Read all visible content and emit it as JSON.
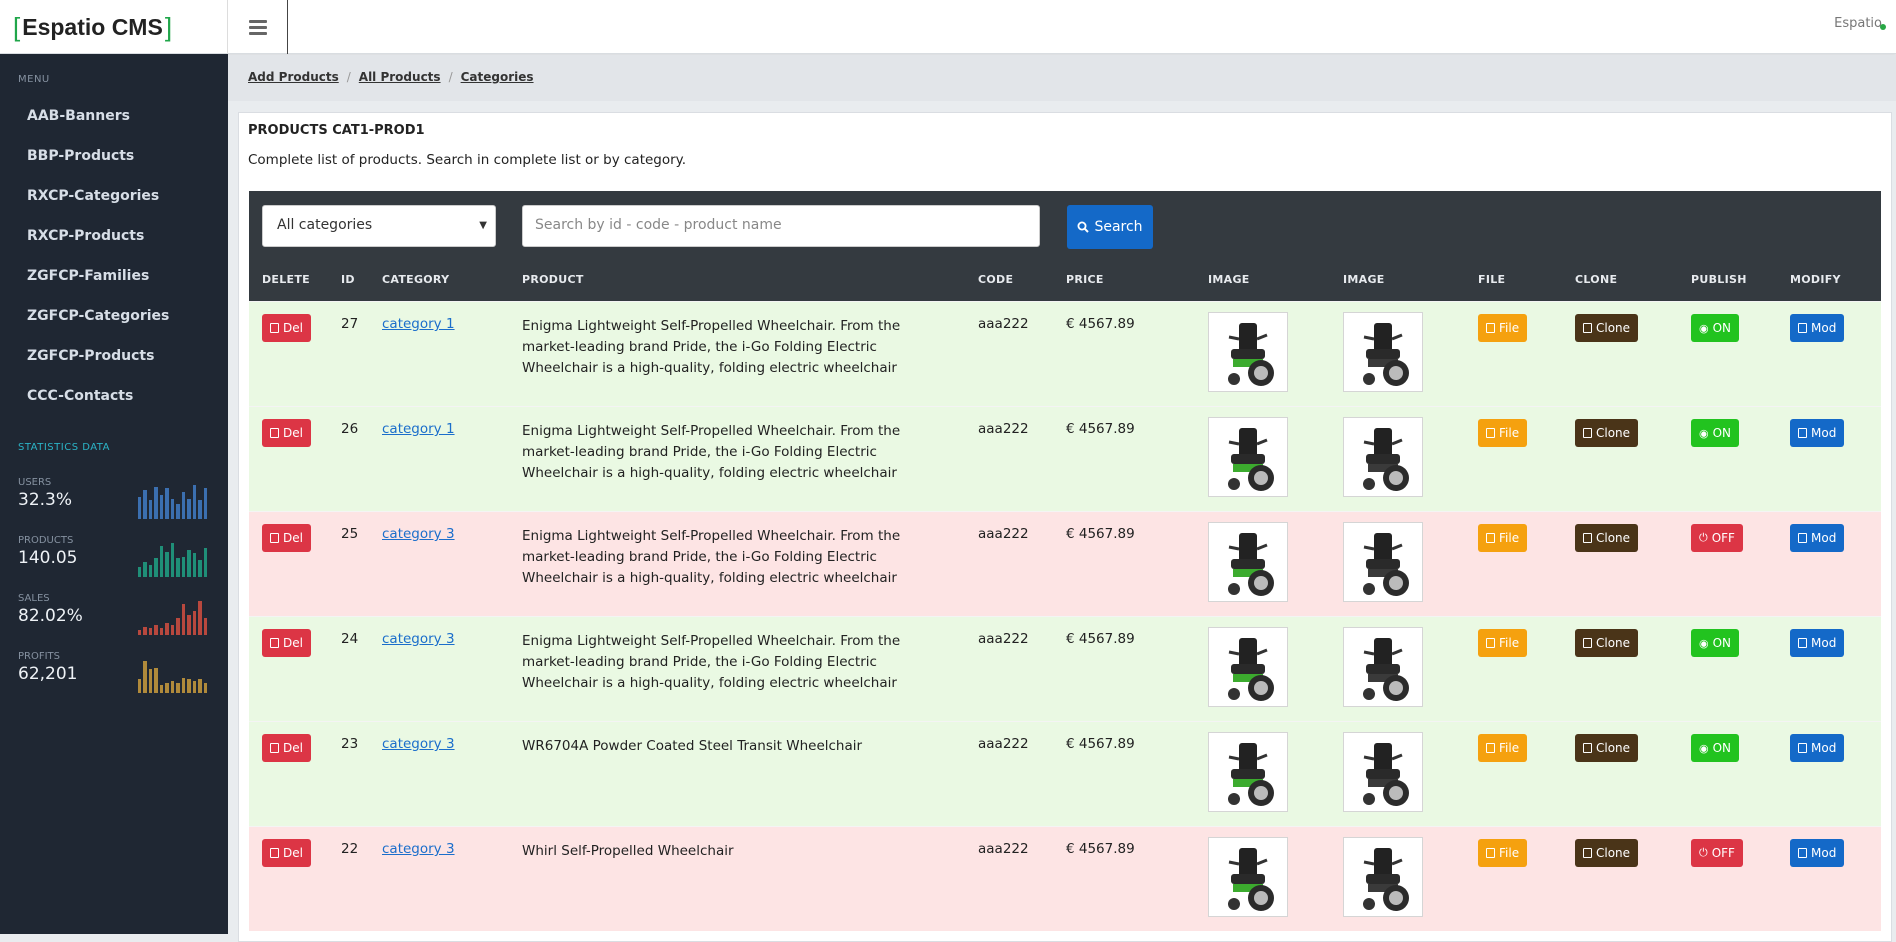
{
  "brand": {
    "name": "Espatio CMS",
    "bracket_left": "[",
    "bracket_right": "]"
  },
  "header": {
    "user_name": "Espatio"
  },
  "sidebar": {
    "menu_title": "MENU",
    "items": [
      {
        "label": "AAB-Banners"
      },
      {
        "label": "BBP-Products"
      },
      {
        "label": "RXCP-Categories"
      },
      {
        "label": "RXCP-Products"
      },
      {
        "label": "ZGFCP-Families"
      },
      {
        "label": "ZGFCP-Categories"
      },
      {
        "label": "ZGFCP-Products"
      },
      {
        "label": "CCC-Contacts"
      }
    ],
    "stats_title": "STATISTICS DATA",
    "stats": [
      {
        "label": "USERS",
        "value": "32.3%",
        "color": "#3b6fb0",
        "bars": [
          0.65,
          0.85,
          0.55,
          0.95,
          0.7,
          0.9,
          0.6,
          0.45,
          0.8,
          0.6,
          1.0,
          0.55,
          0.9
        ]
      },
      {
        "label": "PRODUCTS",
        "value": "140.05",
        "color": "#1f8f78",
        "bars": [
          0.3,
          0.45,
          0.35,
          0.55,
          0.9,
          0.75,
          1.0,
          0.55,
          0.6,
          0.8,
          0.7,
          0.5,
          0.85
        ]
      },
      {
        "label": "SALES",
        "value": "82.02%",
        "color": "#b8483e",
        "bars": [
          0.15,
          0.25,
          0.2,
          0.3,
          0.2,
          0.35,
          0.3,
          0.5,
          0.9,
          0.6,
          0.7,
          1.0,
          0.5
        ]
      },
      {
        "label": "PROFITS",
        "value": "62,201",
        "color": "#b08a3b",
        "bars": [
          0.4,
          0.95,
          0.7,
          0.75,
          0.25,
          0.3,
          0.35,
          0.3,
          0.45,
          0.4,
          0.35,
          0.4,
          0.3
        ]
      }
    ]
  },
  "breadcrumb": [
    "Add Products",
    "All Products",
    "Categories"
  ],
  "main": {
    "title": "PRODUCTS CAT1-PROD1",
    "description": "Complete list of products. Search in complete list or by category.",
    "filter_select": "All categories",
    "search_placeholder": "Search by id - code - product name",
    "search_button": "Search",
    "columns": [
      "DELETE",
      "ID",
      "CATEGORY",
      "PRODUCT",
      "CODE",
      "PRICE",
      "IMAGE",
      "IMAGE",
      "FILE",
      "CLONE",
      "PUBLISH",
      "MODIFY"
    ],
    "buttons": {
      "del": "Del",
      "file": "File",
      "clone": "Clone",
      "mod": "Mod"
    },
    "rows": [
      {
        "id": "27",
        "category": "category 1",
        "product": "Enigma Lightweight Self-Propelled Wheelchair. From the market-leading brand Pride, the i-Go Folding Electric Wheelchair is a high-quality, folding electric wheelchair",
        "code": "aaa222",
        "price": "€ 4567.89",
        "publish": "ON"
      },
      {
        "id": "26",
        "category": "category 1",
        "product": "Enigma Lightweight Self-Propelled Wheelchair. From the market-leading brand Pride, the i-Go Folding Electric Wheelchair is a high-quality, folding electric wheelchair",
        "code": "aaa222",
        "price": "€ 4567.89",
        "publish": "ON"
      },
      {
        "id": "25",
        "category": "category 3",
        "product": "Enigma Lightweight Self-Propelled Wheelchair. From the market-leading brand Pride, the i-Go Folding Electric Wheelchair is a high-quality, folding electric wheelchair",
        "code": "aaa222",
        "price": "€ 4567.89",
        "publish": "OFF"
      },
      {
        "id": "24",
        "category": "category 3",
        "product": "Enigma Lightweight Self-Propelled Wheelchair. From the market-leading brand Pride, the i-Go Folding Electric Wheelchair is a high-quality, folding electric wheelchair",
        "code": "aaa222",
        "price": "€ 4567.89",
        "publish": "ON"
      },
      {
        "id": "23",
        "category": "category 3",
        "product": "WR6704A Powder Coated Steel Transit Wheelchair",
        "code": "aaa222",
        "price": "€ 4567.89",
        "publish": "ON"
      },
      {
        "id": "22",
        "category": "category 3",
        "product": "Whirl Self-Propelled Wheelchair",
        "code": "aaa222",
        "price": "€ 4567.89",
        "publish": "OFF"
      }
    ]
  }
}
